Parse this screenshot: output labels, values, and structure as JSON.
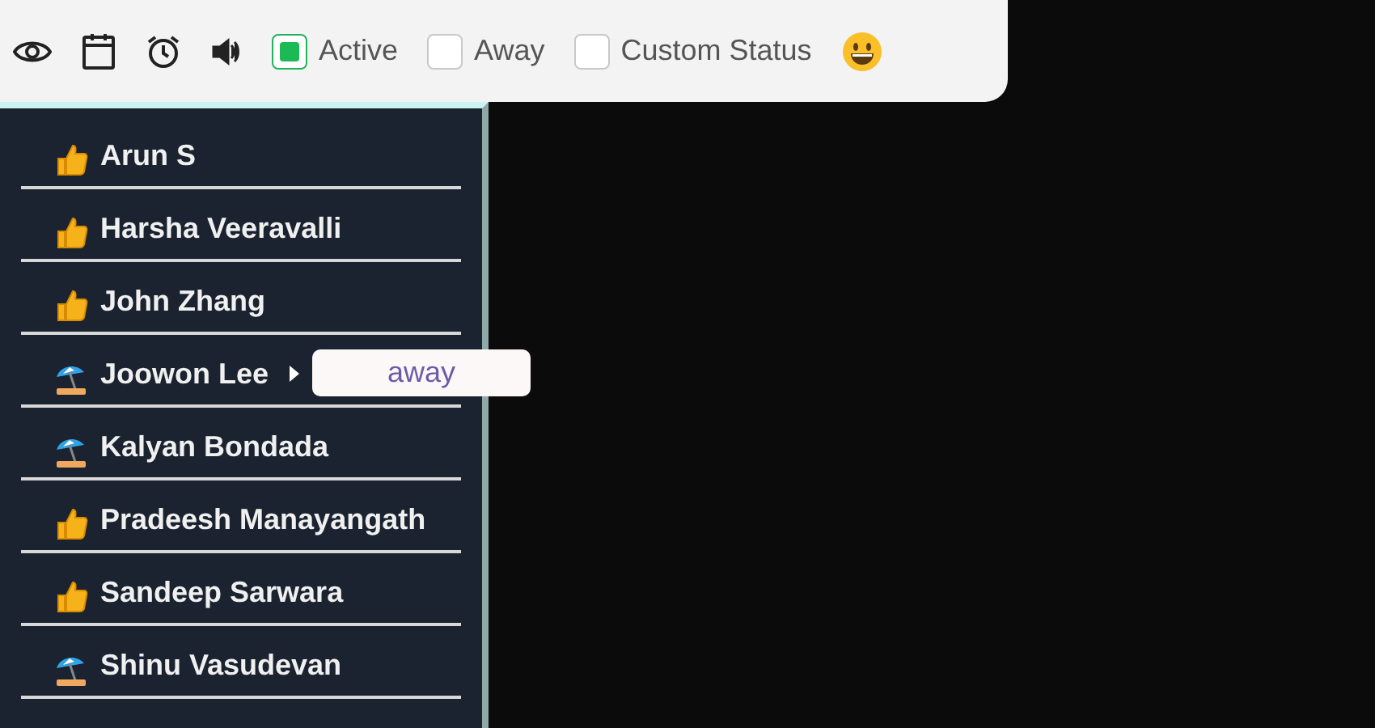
{
  "toolbar": {
    "checkboxes": [
      {
        "label": "Active",
        "checked": true
      },
      {
        "label": "Away",
        "checked": false
      },
      {
        "label": "Custom Status",
        "checked": false
      }
    ]
  },
  "members": [
    {
      "name": "Arun S",
      "kind": "active"
    },
    {
      "name": "Harsha Veeravalli",
      "kind": "active"
    },
    {
      "name": "John Zhang",
      "kind": "active"
    },
    {
      "name": "Joowon Lee",
      "kind": "away",
      "tooltip": "away"
    },
    {
      "name": "Kalyan Bondada",
      "kind": "away"
    },
    {
      "name": "Pradeesh Manayangath",
      "kind": "active"
    },
    {
      "name": "Sandeep Sarwara",
      "kind": "active"
    },
    {
      "name": "Shinu Vasudevan",
      "kind": "away"
    }
  ]
}
